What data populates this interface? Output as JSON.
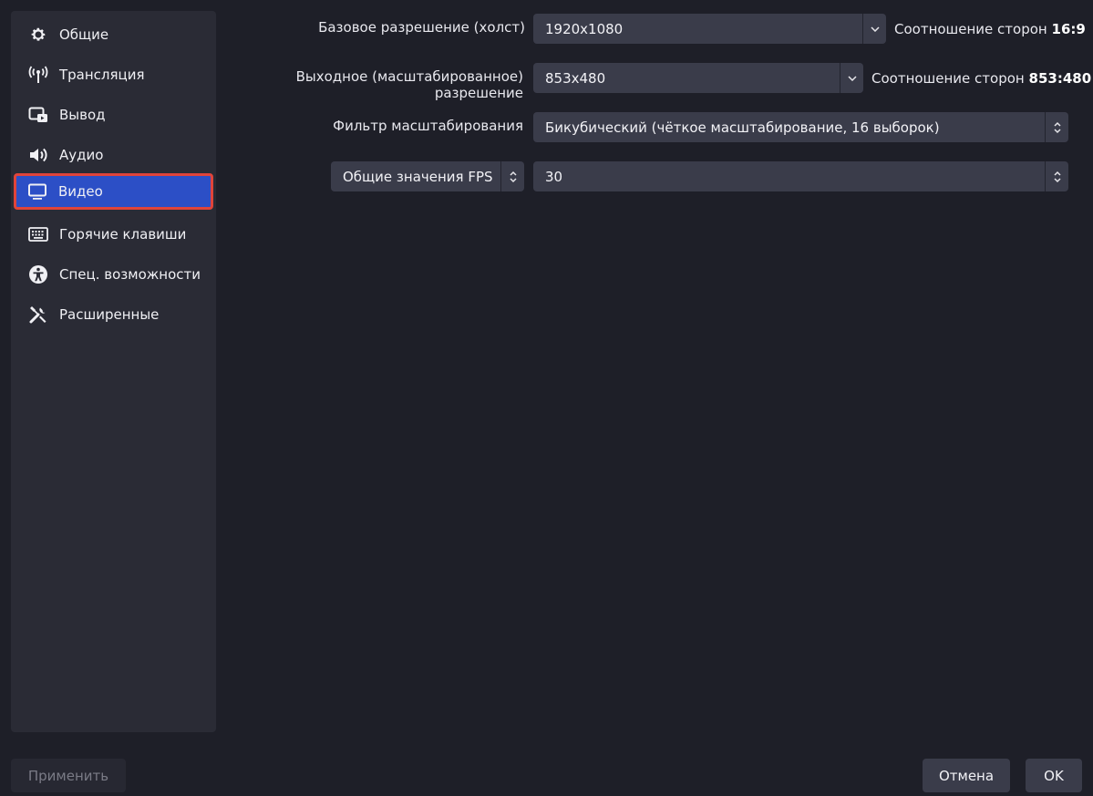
{
  "sidebar": {
    "items": [
      {
        "label": "Общие",
        "icon": "gear-icon"
      },
      {
        "label": "Трансляция",
        "icon": "broadcast-icon"
      },
      {
        "label": "Вывод",
        "icon": "output-icon"
      },
      {
        "label": "Аудио",
        "icon": "speaker-icon"
      },
      {
        "label": "Видео",
        "icon": "monitor-icon",
        "active": true
      },
      {
        "label": "Горячие клавиши",
        "icon": "keyboard-icon"
      },
      {
        "label": "Спец. возможности",
        "icon": "accessibility-icon"
      },
      {
        "label": "Расширенные",
        "icon": "tools-icon"
      }
    ]
  },
  "video": {
    "base_resolution": {
      "label": "Базовое разрешение (холст)",
      "value": "1920x1080",
      "aspect_prefix": "Соотношение сторон",
      "aspect_value": "16:9"
    },
    "output_resolution": {
      "label": "Выходное (масштабированное) разрешение",
      "value": "853x480",
      "aspect_prefix": "Соотношение сторон",
      "aspect_value": "853:480"
    },
    "downscale_filter": {
      "label": "Фильтр масштабирования",
      "value": "Бикубический (чёткое масштабирование, 16 выборок)"
    },
    "fps": {
      "type_value": "Общие значения FPS",
      "value": "30"
    }
  },
  "footer": {
    "apply_label": "Применить",
    "cancel_label": "Отмена",
    "ok_label": "OK"
  },
  "colors": {
    "background": "#1e1f28",
    "panel": "#2a2b35",
    "field": "#3a3c4a",
    "active": "#2c4fc6",
    "highlight_border": "#e0443a"
  }
}
